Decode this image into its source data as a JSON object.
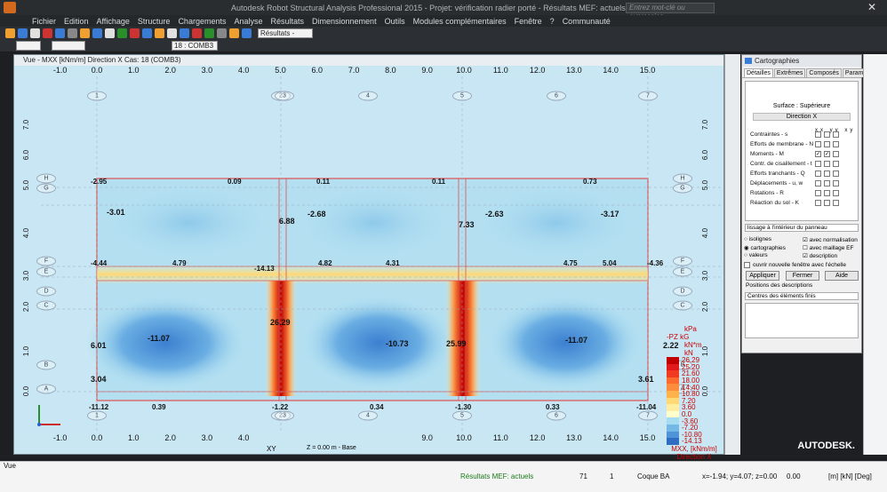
{
  "app": {
    "title": "Autodesk Robot Structural Analysis Professional 2015 - Projet: vérification radier porté - Résultats MEF: actuels",
    "search_placeholder": "Entrez mot-clé ou expression",
    "menu": [
      "Fichier",
      "Edition",
      "Affichage",
      "Structure",
      "Chargements",
      "Analyse",
      "Résultats",
      "Dimensionnement",
      "Outils",
      "Modules complémentaires",
      "Fenêtre",
      "?",
      "Communauté"
    ],
    "toolbar": {
      "results_combo": "Résultats - cartog.",
      "case_combo": "18 : COMB3"
    }
  },
  "view": {
    "title": "Vue - MXX [kNm/m] Direction X Cas: 18 (COMB3)",
    "x_ticks": [
      "-1.0",
      "0.0",
      "1.0",
      "2.0",
      "3.0",
      "4.0",
      "5.0",
      "6.0",
      "7.0",
      "8.0",
      "9.0",
      "10.0",
      "11.0",
      "12.0",
      "13.0",
      "14.0",
      "15.0"
    ],
    "x_ticks_bottom": [
      "-1.0",
      "0.0",
      "1.0",
      "2.0",
      "3.0",
      "4.0",
      "9.0",
      "10.0",
      "11.0",
      "12.0",
      "13.0",
      "14.0",
      "15.0"
    ],
    "y_ticks": [
      "7.0",
      "6.0",
      "5.0",
      "4.0",
      "3.0",
      "2.0",
      "1.0",
      "0.0"
    ],
    "grid_top": [
      "1",
      "2",
      "3",
      "4",
      "5",
      "6",
      "7"
    ],
    "grid_left": [
      "H",
      "G",
      "F",
      "E",
      "D",
      "C",
      "B",
      "A"
    ],
    "slab_top_values": [
      "-2.95",
      "0.09",
      "0.11",
      "0.11",
      "0.73"
    ],
    "slab_mid_values": [
      "-4.44",
      "4.79",
      "-14.13",
      "4.82",
      "4.31",
      "4.75",
      "5.04",
      "-4.36"
    ],
    "slab_bottom_values": [
      "-11.12",
      "0.39",
      "-1.22",
      "0.34",
      "-1.30",
      "0.33",
      "-11.04"
    ],
    "peak_values": [
      "26.29",
      "25.99",
      "-11.07",
      "-10.73",
      "-11.07",
      "-3.01",
      "-2.68",
      "-2.63",
      "-3.17",
      "7.33",
      "6.88",
      "3.04",
      "3.61",
      "2.22",
      "6.01"
    ],
    "bottom_tab": {
      "plane": "XY",
      "z_value": "Z = 0.00 m - Base"
    }
  },
  "legend": {
    "units": [
      "kPa",
      "kG",
      "kN*m",
      "kN"
    ],
    "unit_prefix": "-PZ",
    "levels": [
      "26.29",
      "25.20",
      "21.60",
      "18.00",
      "14.40",
      "10.80",
      "7.20",
      "3.60",
      "0.0",
      "-3.60",
      "-7.20",
      "-10.80",
      "-14.13"
    ],
    "colors": [
      "#c00000",
      "#e31a1c",
      "#f03b20",
      "#fd6a2e",
      "#fd8d3c",
      "#feb24c",
      "#fed976",
      "#ffeda0",
      "#ffffcc",
      "#a6dcef",
      "#74b8e6",
      "#4f94d6",
      "#2f6dc2"
    ],
    "footer": [
      "MXX, [kNm/m]",
      "Direction X",
      "Cas: 18 (COMB3)"
    ]
  },
  "panel": {
    "title": "Cartographies",
    "tabs": [
      "Détailles",
      "Extrêmes",
      "Composés",
      "Paramètres"
    ],
    "surface": "Surface : Supérieure",
    "direction": "Direction X",
    "cols": "xx yy xy z",
    "options": [
      "Contraintes - s",
      "Efforts de membrane - N",
      "Moments - M",
      "Contr. de cisaillement - t",
      "Efforts tranchants - Q",
      "Déplacements - u, w",
      "Rotations - R",
      "Réaction du sol - K"
    ],
    "smoothing": "lissage à l'intérieur du panneau",
    "display": [
      "isolignes",
      "cartographies",
      "valeurs"
    ],
    "display_right": [
      "avec normalisation",
      "avec maillage EF",
      "description"
    ],
    "new_window": "ouvrir nouvelle fenêtre avec l'échelle",
    "buttons": [
      "Appliquer",
      "Fermer",
      "Aide"
    ],
    "desc_label": "Positions des descriptions",
    "desc_value": "Centres des éléments finis"
  },
  "status": {
    "view_label": "Vue",
    "results": "Résultats MEF: actuels",
    "node": "71",
    "count": "1",
    "elem": "Coque BA",
    "coords": "x=-1.94; y=4.07; z=0.00",
    "angle": "0.00",
    "units": "[m] [kN] [Deg]"
  },
  "brand": "AUTODESK."
}
